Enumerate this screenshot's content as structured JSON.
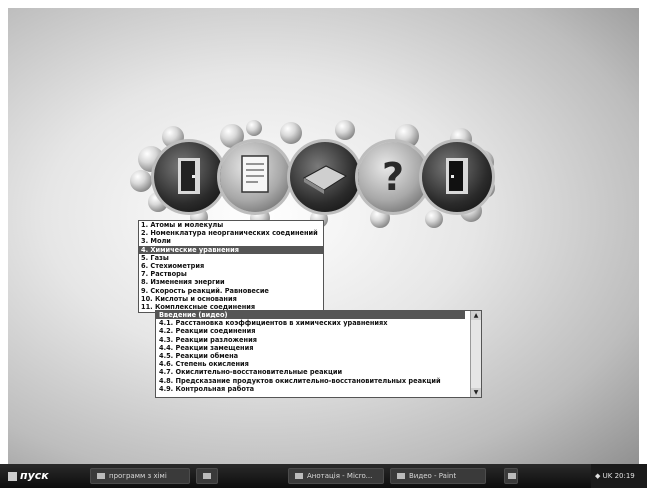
{
  "menu_icons": [
    "door-enter-icon",
    "document-icon",
    "book-icon",
    "help-icon",
    "door-exit-icon"
  ],
  "topics": [
    "1. Атомы и молекулы",
    "2. Номенклатура неорганических соединений",
    "3. Моли",
    "4. Химические уравнения",
    "5. Газы",
    "6. Стехиометрия",
    "7. Растворы",
    "8. Изменения энергии",
    "9. Скорость реакций. Равновесие",
    "10. Кислоты и основания",
    "11. Комплексные соединения"
  ],
  "selected_topic": 3,
  "subtopics": [
    "Введение (видео)",
    "4.1. Расстановка коэффициентов в химических уравнениях",
    "4.2. Реакции соединения",
    "4.3. Реакции разложения",
    "4.4. Реакции замещения",
    "4.5. Реакции обмена",
    "4.6. Степень окисления",
    "4.7. Окислительно-восстановительные реакции",
    "4.8. Предсказание продуктов окислительно-восстановительных реакций",
    "4.9. Контрольная работа"
  ],
  "taskbar": {
    "start_label": "пуск",
    "buttons": [
      "программ з хімі",
      "",
      "Анотація - Micro...",
      "Видео - Paint"
    ],
    "clock": "20:19",
    "lang": "UK"
  }
}
